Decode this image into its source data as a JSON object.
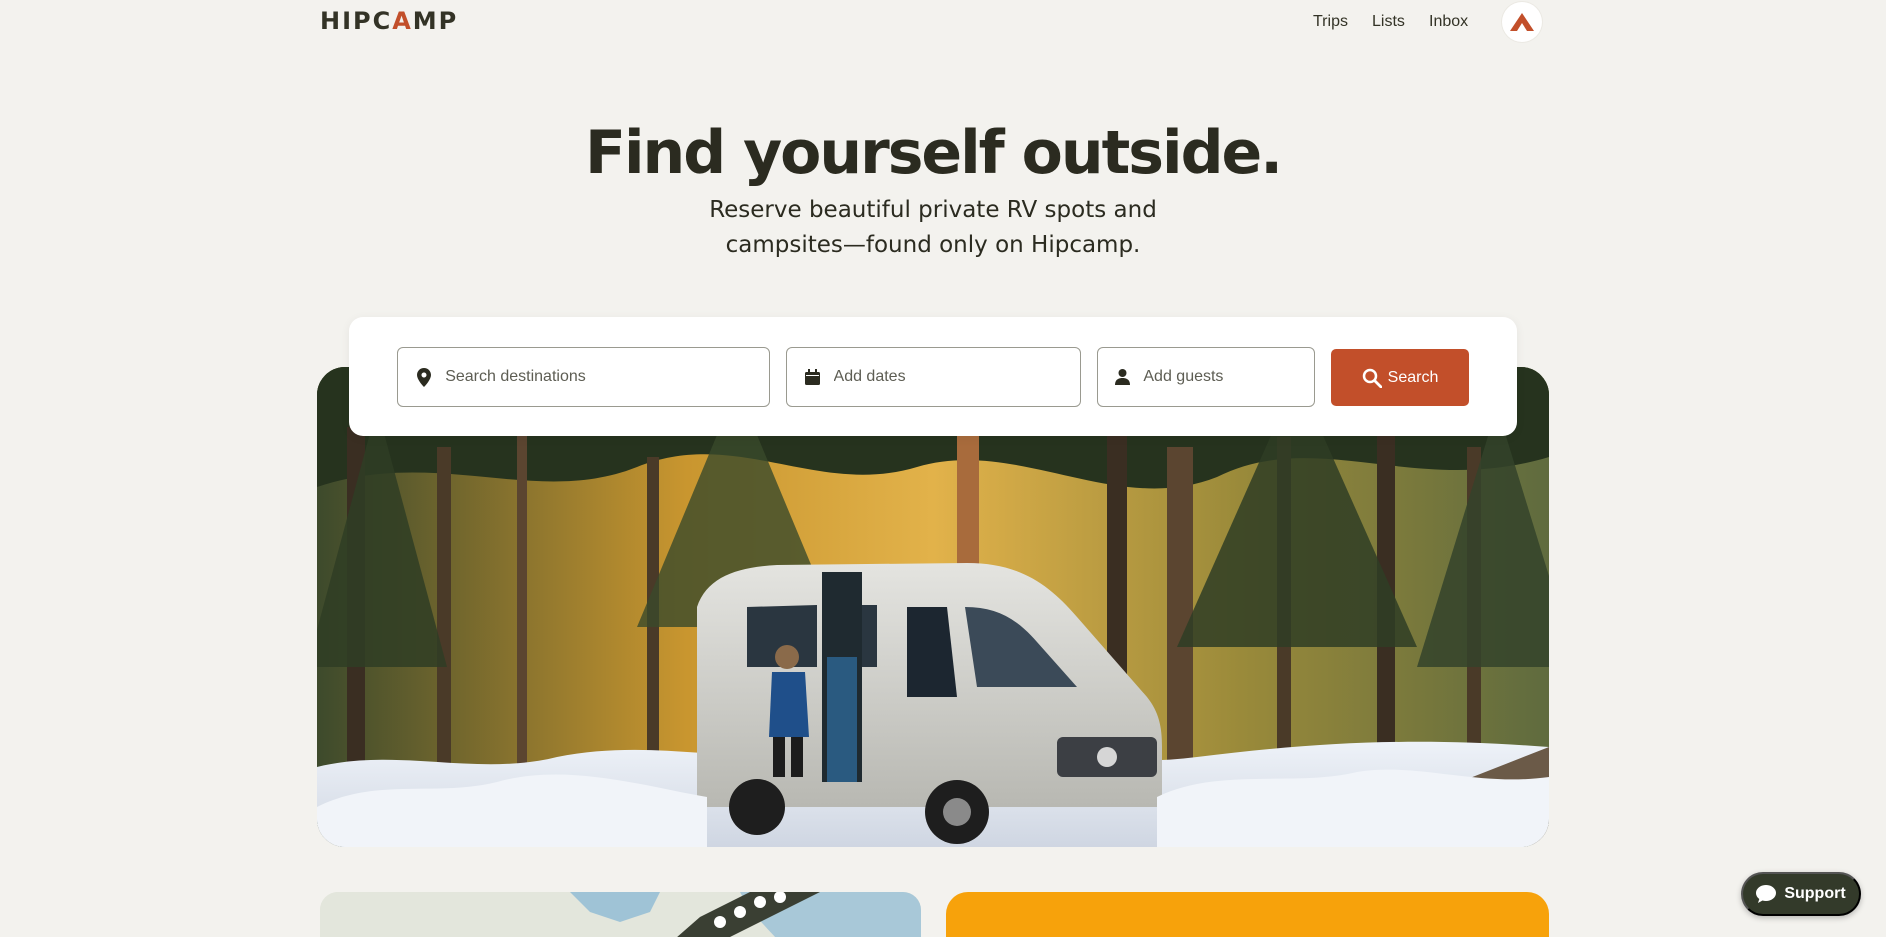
{
  "header": {
    "logo_left": "HIPC",
    "logo_accent": "A",
    "logo_right": "MP",
    "nav": {
      "trips": "Trips",
      "lists": "Lists",
      "inbox": "Inbox"
    },
    "avatar_icon": "hipcamp-tent-icon"
  },
  "hero": {
    "title": "Find yourself outside.",
    "subtitle": "Reserve beautiful private RV spots and campsites—found only on Hipcamp."
  },
  "search": {
    "destination_placeholder": "Search destinations",
    "dates_placeholder": "Add dates",
    "guests_placeholder": "Add guests",
    "button_label": "Search",
    "icons": {
      "destination": "map-pin-icon",
      "dates": "calendar-icon",
      "guests": "person-icon",
      "button": "search-icon"
    }
  },
  "support": {
    "label": "Support",
    "icon": "chat-bubble-icon"
  },
  "colors": {
    "brand": "#c24f2a",
    "background": "#f3f2ee",
    "dark": "#333a2a",
    "yellow": "#f7a20b"
  }
}
